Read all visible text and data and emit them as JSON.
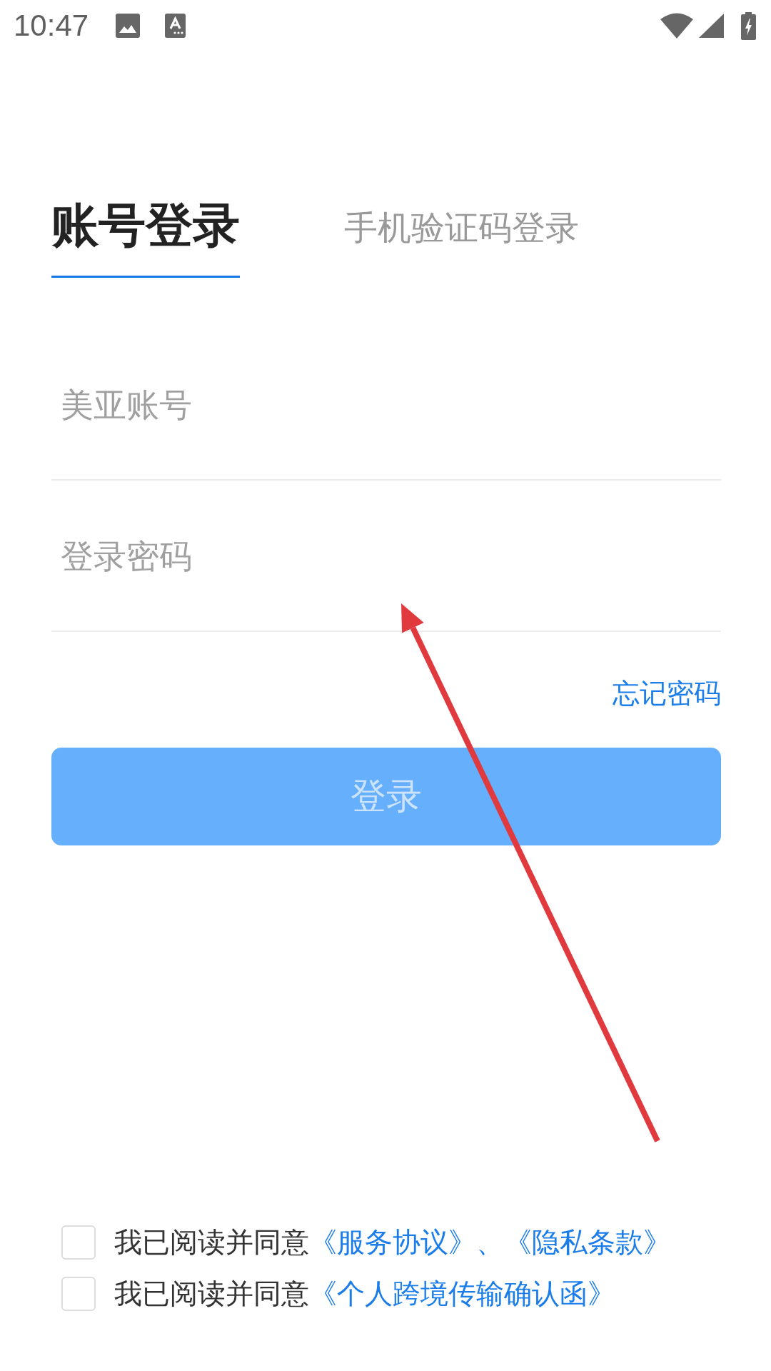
{
  "status_bar": {
    "time": "10:47"
  },
  "tabs": [
    {
      "label": "账号登录",
      "selected": true
    },
    {
      "label": "手机验证码登录",
      "selected": false
    }
  ],
  "fields": [
    {
      "placeholder": "美亚账号"
    },
    {
      "placeholder": "登录密码"
    }
  ],
  "forgot_password_link": "忘记密码",
  "login_button": {
    "label": "登录",
    "disabled": true
  },
  "agreements": [
    {
      "checked": false,
      "text": "我已阅读并同意",
      "links": [
        "《服务协议》",
        "《隐私条款》"
      ],
      "separator": "、"
    },
    {
      "checked": false,
      "text": "我已阅读并同意",
      "links": [
        "《个人跨境传输确认函》"
      ]
    }
  ]
}
